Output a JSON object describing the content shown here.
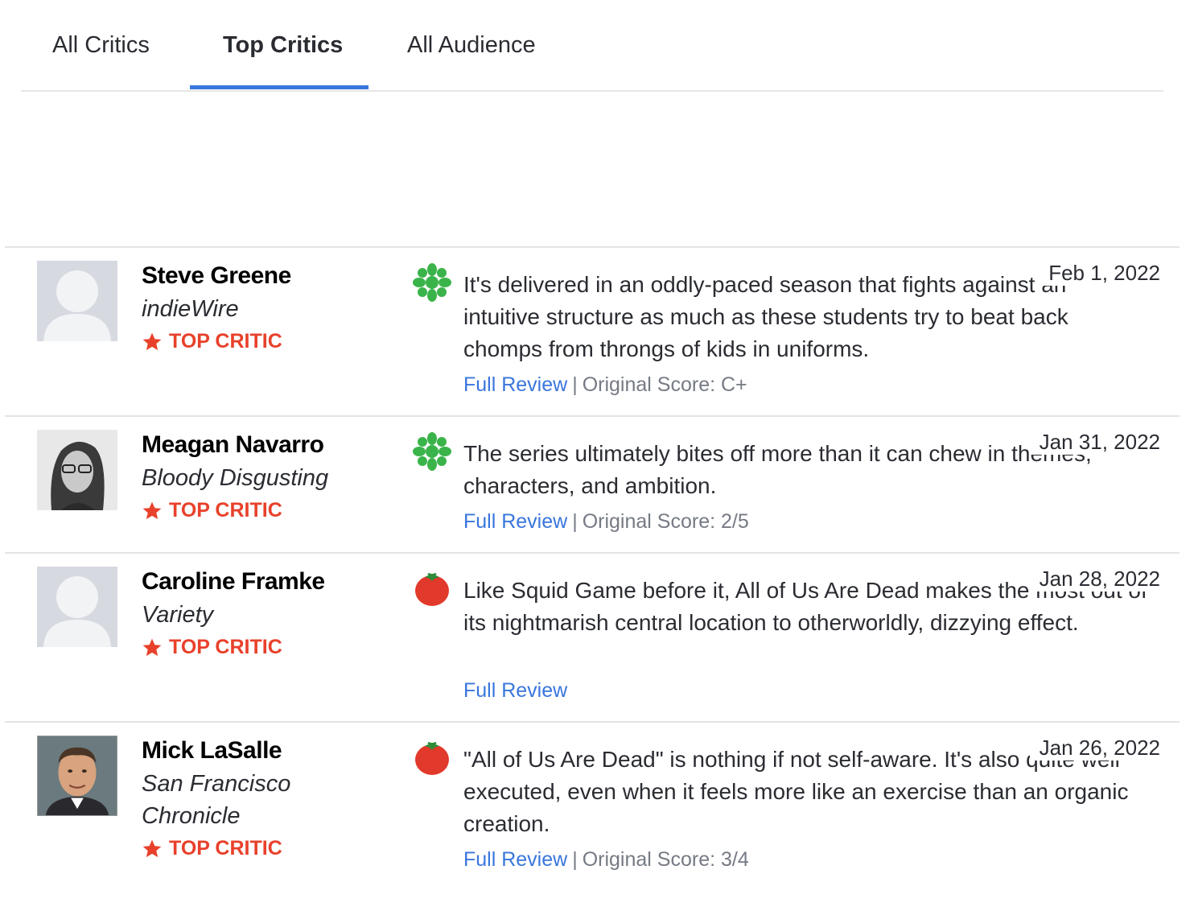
{
  "tabs": [
    {
      "label": "All Critics"
    },
    {
      "label": "Top Critics"
    },
    {
      "label": "All Audience"
    }
  ],
  "active_tab": "Top Critics",
  "colors": {
    "accent_blue": "#3976dc",
    "top_critic_red": "#e8412b",
    "rotten_green": "#3ab44a",
    "fresh_red": "#e1392b"
  },
  "top_critic_label": "TOP CRITIC",
  "full_review_label": "Full Review",
  "reviews": [
    {
      "critic": "Steve Greene",
      "publication": "indieWire",
      "avatar": "placeholder",
      "score_icon": "rotten-splat-icon",
      "quote": "It's delivered in an oddly-paced season that fights against an intuitive structure as much as these students try to beat back chomps from throngs of kids in uniforms.",
      "date": "Feb 1, 2022",
      "original_score": "Original Score: C+"
    },
    {
      "critic": "Meagan Navarro",
      "publication": "Bloody Disgusting",
      "avatar": "photo",
      "score_icon": "rotten-splat-icon",
      "quote": "The series ultimately bites off more than it can chew in themes, characters, and ambition.",
      "date": "Jan 31, 2022",
      "original_score": "Original Score: 2/5"
    },
    {
      "critic": "Caroline Framke",
      "publication": "Variety",
      "avatar": "placeholder",
      "score_icon": "fresh-tomato-icon",
      "quote": "Like Squid Game before it, All of Us Are Dead makes the most out of its nightmarish central location to otherworldly, dizzying effect.",
      "date": "Jan 28, 2022",
      "original_score": ""
    },
    {
      "critic": "Mick LaSalle",
      "publication": "San Francisco Chronicle",
      "avatar": "photo",
      "score_icon": "fresh-tomato-icon",
      "quote": "\"All of Us Are Dead\" is nothing if not self-aware. It's also quite well executed, even when it feels more like an exercise than an organic creation.",
      "date": "Jan 26, 2022",
      "original_score": "Original Score: 3/4"
    }
  ]
}
